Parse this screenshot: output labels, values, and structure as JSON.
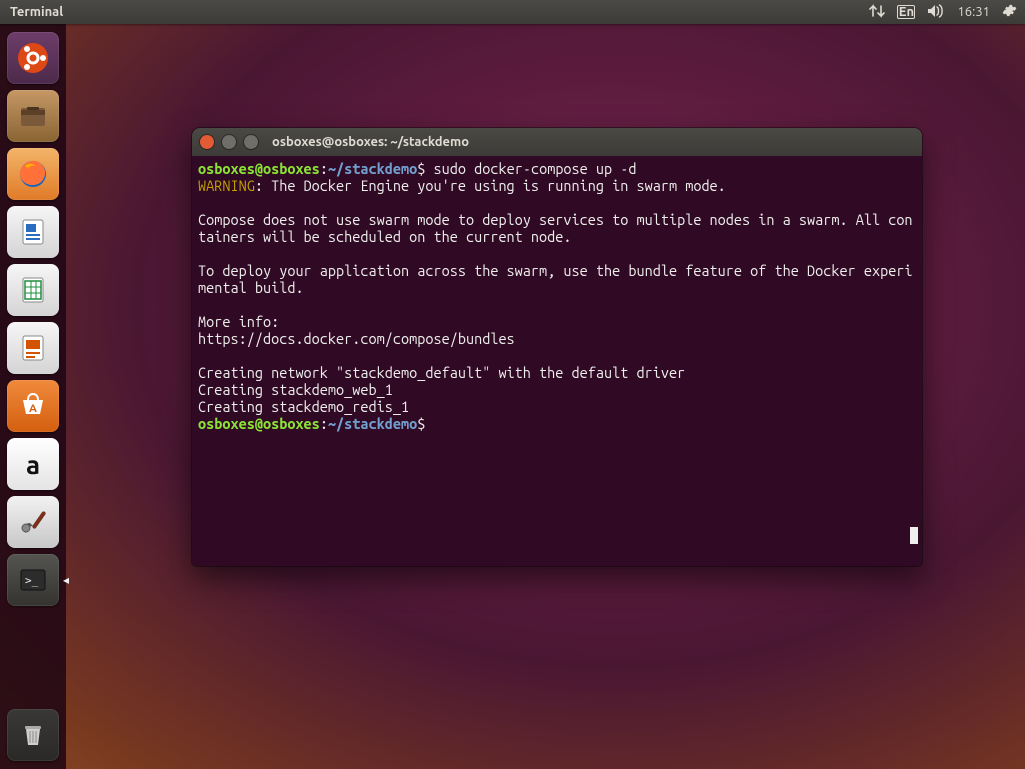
{
  "menubar": {
    "app_name": "Terminal",
    "lang_indicator": "En",
    "clock": "16:31"
  },
  "launcher": {
    "items": [
      {
        "name": "dash",
        "label": "Dash"
      },
      {
        "name": "files",
        "label": "Files"
      },
      {
        "name": "firefox",
        "label": "Firefox"
      },
      {
        "name": "writer",
        "label": "LibreOffice Writer"
      },
      {
        "name": "calc",
        "label": "LibreOffice Calc"
      },
      {
        "name": "impress",
        "label": "LibreOffice Impress"
      },
      {
        "name": "software",
        "label": "Ubuntu Software"
      },
      {
        "name": "amazon",
        "label": "Amazon"
      },
      {
        "name": "settings",
        "label": "System Settings"
      },
      {
        "name": "terminal",
        "label": "Terminal"
      }
    ],
    "trash_label": "Trash"
  },
  "terminal": {
    "title": "osboxes@osboxes: ~/stackdemo",
    "prompt": {
      "user": "osboxes@osboxes",
      "sep": ":",
      "path": "~/stackdemo",
      "sym": "$"
    },
    "command": "sudo docker-compose up -d",
    "warning_label": "WARNING",
    "warning_text": ": The Docker Engine you're using is running in swarm mode.",
    "body1": "Compose does not use swarm mode to deploy services to multiple nodes in a swarm. All containers will be scheduled on the current node.",
    "body2": "To deploy your application across the swarm, use the bundle feature of the Docker experimental build.",
    "more_label": "More info:",
    "more_url": "https://docs.docker.com/compose/bundles",
    "creating": [
      "Creating network \"stackdemo_default\" with the default driver",
      "Creating stackdemo_web_1",
      "Creating stackdemo_redis_1"
    ]
  }
}
